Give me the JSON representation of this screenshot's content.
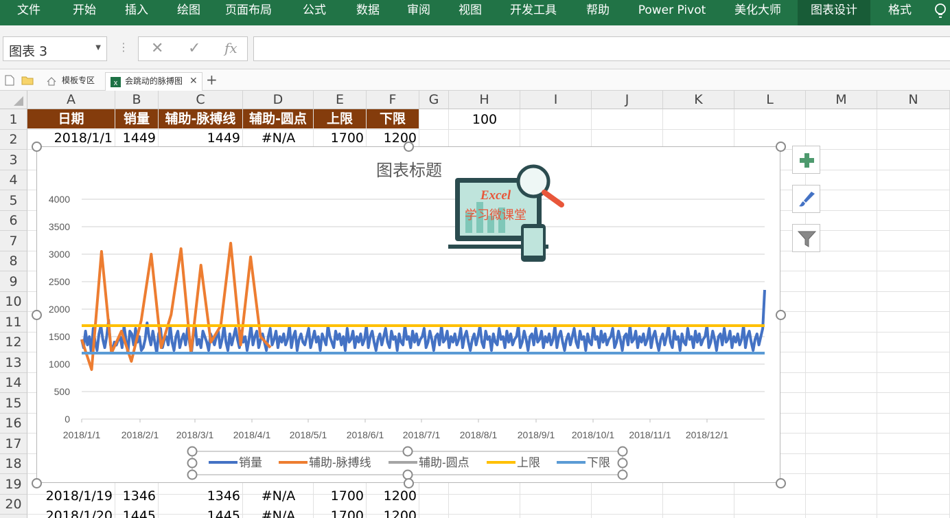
{
  "ribbon": {
    "tabs": [
      "文件",
      "开始",
      "插入",
      "绘图",
      "页面布局",
      "公式",
      "数据",
      "审阅",
      "视图",
      "开发工具",
      "帮助",
      "Power Pivot",
      "美化大师",
      "图表设计",
      "格式"
    ],
    "active": "图表设计"
  },
  "formula_bar": {
    "name_box": "图表 3",
    "cancel": "✕",
    "enter": "✓",
    "fx": "fx",
    "formula": ""
  },
  "doc_tabs": {
    "template_zone": "模板专区",
    "file_name": "会跳动的脉搏图",
    "add": "+"
  },
  "grid": {
    "columns": [
      "A",
      "B",
      "C",
      "D",
      "E",
      "F",
      "G",
      "H",
      "I",
      "J",
      "K",
      "L",
      "M",
      "N"
    ],
    "rows": [
      "1",
      "2",
      "3",
      "4",
      "5",
      "6",
      "7",
      "8",
      "9",
      "10",
      "11",
      "12",
      "13",
      "14",
      "15",
      "16",
      "17",
      "18",
      "19",
      "20",
      "21"
    ],
    "header": [
      "日期",
      "销量",
      "辅助-脉搏线",
      "辅助-圆点",
      "上限",
      "下限"
    ],
    "h1": "100",
    "row2": [
      "2018/1/1",
      "1449",
      "1449",
      "#N/A",
      "1700",
      "1200"
    ],
    "row20": [
      "2018/1/19",
      "1346",
      "1346",
      "#N/A",
      "1700",
      "1200"
    ],
    "row21": [
      "2018/1/20",
      "1445",
      "1445",
      "#N/A",
      "1700",
      "1200"
    ]
  },
  "chart_data": {
    "type": "line",
    "title": "图表标题",
    "y_ticks": [
      "0",
      "500",
      "1000",
      "1500",
      "2000",
      "2500",
      "3000",
      "3500",
      "4000"
    ],
    "ylim": [
      0,
      4000
    ],
    "x_ticks": [
      "2018/1/1",
      "2018/2/1",
      "2018/3/1",
      "2018/4/1",
      "2018/5/1",
      "2018/6/1",
      "2018/7/1",
      "2018/8/1",
      "2018/9/1",
      "2018/10/1",
      "2018/11/1",
      "2018/12/1"
    ],
    "grid": true,
    "legend_position": "bottom",
    "series": [
      {
        "name": "销量",
        "color": "#4472c4",
        "values": [
          1449,
          1300,
          1600,
          1350,
          1500,
          1200,
          1650,
          1400,
          1250,
          1550,
          1700,
          1450,
          1300,
          1500,
          1800,
          1350,
          1250,
          1400,
          1346,
          1445,
          1500,
          1300,
          1700,
          1450,
          1200,
          1600,
          1550,
          1350,
          1650,
          1400,
          1500,
          1250,
          1300,
          1450,
          1750,
          1500,
          1350,
          1600,
          1400,
          1200,
          1550,
          1650,
          1300,
          1450,
          1500,
          1350,
          1700,
          1400,
          1250,
          1500,
          1600,
          1300,
          1450,
          1550,
          1350,
          1650,
          1400,
          1200,
          1500,
          1700,
          1350,
          1450,
          1300,
          1600,
          1500,
          1400,
          1250,
          1550,
          1450,
          1350,
          1500,
          1600,
          1300,
          1450,
          1700,
          1400,
          1250,
          1550,
          1350,
          1500,
          1650,
          1450,
          1300,
          1600,
          1400,
          1500,
          1250,
          1450,
          1700,
          1350,
          1500,
          1600,
          1300,
          1450,
          1550,
          1400,
          1250,
          1500,
          1650,
          1350,
          1450,
          1600,
          1300,
          1500,
          1400,
          1550,
          1350,
          1450,
          1700,
          1300,
          1500,
          1600,
          1250,
          1450,
          1550,
          1400,
          1350,
          1500,
          1650,
          1300,
          1450,
          1600,
          1400,
          1500,
          1250,
          1550,
          1450,
          1350,
          1700,
          1500,
          1400,
          1300,
          1600,
          1450,
          1550,
          1350,
          1500,
          1250,
          1650,
          1400,
          1450,
          1600,
          1300,
          1500,
          1400,
          1550,
          1350,
          1450,
          1700,
          1300,
          1500,
          1600,
          1400,
          1250,
          1450,
          1550,
          1350,
          1500,
          1650,
          1400,
          1300,
          1600,
          1450,
          1500,
          1250,
          1550,
          1400,
          1350,
          1700,
          1450,
          1500,
          1300,
          1600,
          1400,
          1550,
          1350,
          1450,
          1500,
          1650,
          1300,
          1400,
          1600,
          1450,
          1250,
          1500,
          1550,
          1350,
          1700,
          1400,
          1450,
          1600,
          1300,
          1500,
          1400,
          1550,
          1350,
          1450,
          1650,
          1300,
          1500,
          1600,
          1400,
          1250,
          1450,
          1550,
          1350,
          1500,
          1700,
          1400,
          1300,
          1600,
          1450,
          1500,
          1250,
          1550,
          1400,
          1350,
          1650,
          1450,
          1500,
          1300,
          1600,
          1400,
          1550,
          1350,
          1450,
          1500,
          1700,
          1300,
          1400,
          1600,
          1450,
          1250,
          1500,
          1550,
          1350,
          1650,
          1400,
          1450,
          1600,
          1300,
          1500,
          1400,
          1550,
          1350,
          1450,
          1700,
          1300,
          1500,
          1600,
          1400,
          1250,
          1450,
          1550,
          1350,
          1500,
          1650,
          1400,
          1300,
          1600,
          1450,
          1500,
          1250,
          1550,
          1400,
          1350,
          1700,
          1450,
          1500,
          1300,
          1600,
          1400,
          1550,
          1350,
          1450,
          1500,
          1650,
          1300,
          1400,
          1600,
          1450,
          1250,
          1500,
          1550,
          1350,
          1700,
          1400,
          1450,
          1600,
          1300,
          1500,
          1400,
          1550,
          1350,
          1450,
          1650,
          1300,
          1500,
          1600,
          1400,
          1250,
          1450,
          1550,
          1350,
          1500,
          1700,
          1400,
          1300,
          1600,
          1450,
          1500,
          1250,
          1550,
          1400,
          1350,
          1650,
          1450,
          1500,
          1300,
          1600,
          1400,
          1550,
          1350,
          1450,
          1500,
          1700,
          1300,
          1400,
          1600,
          1450,
          1250,
          1500,
          1550,
          1350,
          1650,
          1400,
          1450,
          1600,
          1300,
          1500,
          1400,
          1550,
          1350,
          1450,
          1700,
          1300,
          1500,
          1600,
          1400,
          1250,
          1450,
          1550,
          1350,
          1500,
          1650,
          2350
        ]
      },
      {
        "name": "辅助-脉搏线",
        "color": "#ed7d31",
        "values": [
          1449,
          900,
          3050,
          1200,
          1600,
          1050,
          1800,
          3000,
          1300,
          1900,
          3100,
          1200,
          2800,
          1400,
          1700,
          3200,
          1350,
          2950,
          1500,
          1300
        ]
      },
      {
        "name": "辅助-圆点",
        "color": "#a5a5a5",
        "values": []
      },
      {
        "name": "上限",
        "color": "#ffc000",
        "values": [
          1700,
          1700
        ]
      },
      {
        "name": "下限",
        "color": "#5b9bd5",
        "values": [
          1200,
          1200
        ]
      }
    ]
  },
  "chart_ui": {
    "add_element": "+",
    "styles": "brush",
    "filter": "funnel"
  },
  "logo": {
    "word": "Excel",
    "subtitle": "学习微课堂"
  }
}
